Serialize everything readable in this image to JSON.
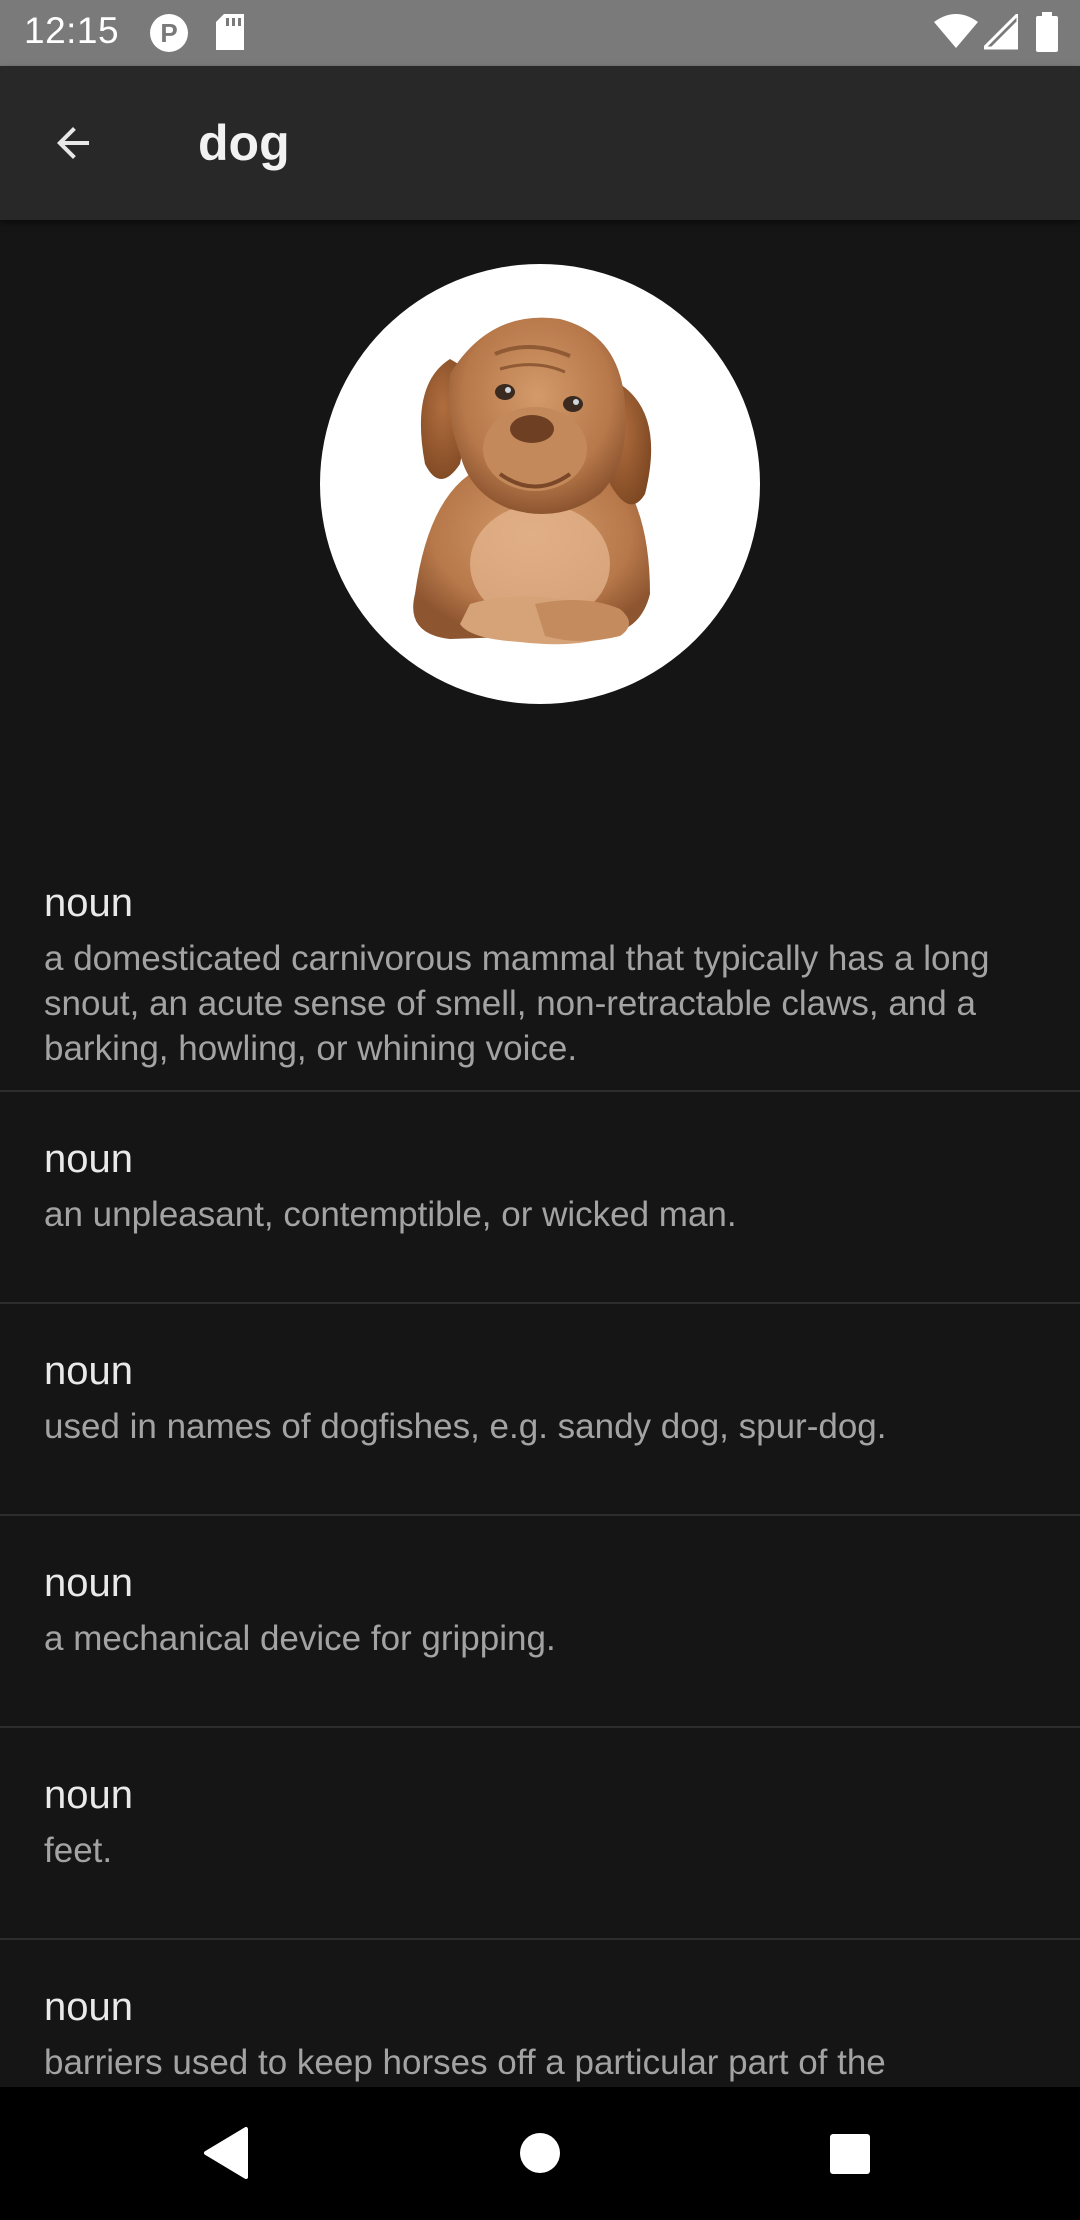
{
  "status_bar": {
    "time": "12:15",
    "p_icon_letter": "P"
  },
  "app_bar": {
    "title": "dog"
  },
  "definitions": [
    {
      "pos": "noun",
      "text": "a domesticated carnivorous mammal that typically has a long snout, an acute sense of smell, non-retractable claws, and a barking, howling, or whining voice."
    },
    {
      "pos": "noun",
      "text": "an unpleasant, contemptible, or wicked man."
    },
    {
      "pos": "noun",
      "text": "used in names of dogfishes, e.g. sandy dog, spur-dog."
    },
    {
      "pos": "noun",
      "text": "a mechanical device for gripping."
    },
    {
      "pos": "noun",
      "text": "feet."
    },
    {
      "pos": "noun",
      "text": "barriers used to keep horses off a particular part of the"
    }
  ],
  "colors": {
    "background": "#151516",
    "app_bar": "#282829",
    "status_bar": "#7a7a7a",
    "divider": "#2c2c2d",
    "secondary_text": "#a3a3a3"
  },
  "icons": {
    "back": "arrow-back-icon",
    "nav_back": "triangle-back-icon",
    "nav_home": "circle-home-icon",
    "nav_recents": "square-recents-icon"
  }
}
